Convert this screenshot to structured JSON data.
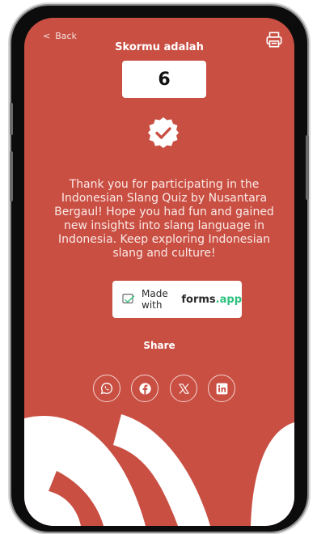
{
  "header": {
    "back_label": "Back"
  },
  "score": {
    "title": "Skormu adalah",
    "value": "6"
  },
  "message": "Thank you for participating in the Indonesian Slang Quiz by Nusantara Bergaul! Hope you had fun and gained new insights into slang language in Indonesia. Keep exploring Indonesian slang and culture!",
  "made_with": {
    "text": "Made with",
    "brand": "forms",
    "brand_suffix": ".app"
  },
  "share": {
    "label": "Share",
    "networks": [
      "whatsapp-icon",
      "facebook-icon",
      "x-icon",
      "linkedin-icon"
    ]
  },
  "colors": {
    "background": "#c94f43",
    "accent_dot": "#2ec27e"
  }
}
